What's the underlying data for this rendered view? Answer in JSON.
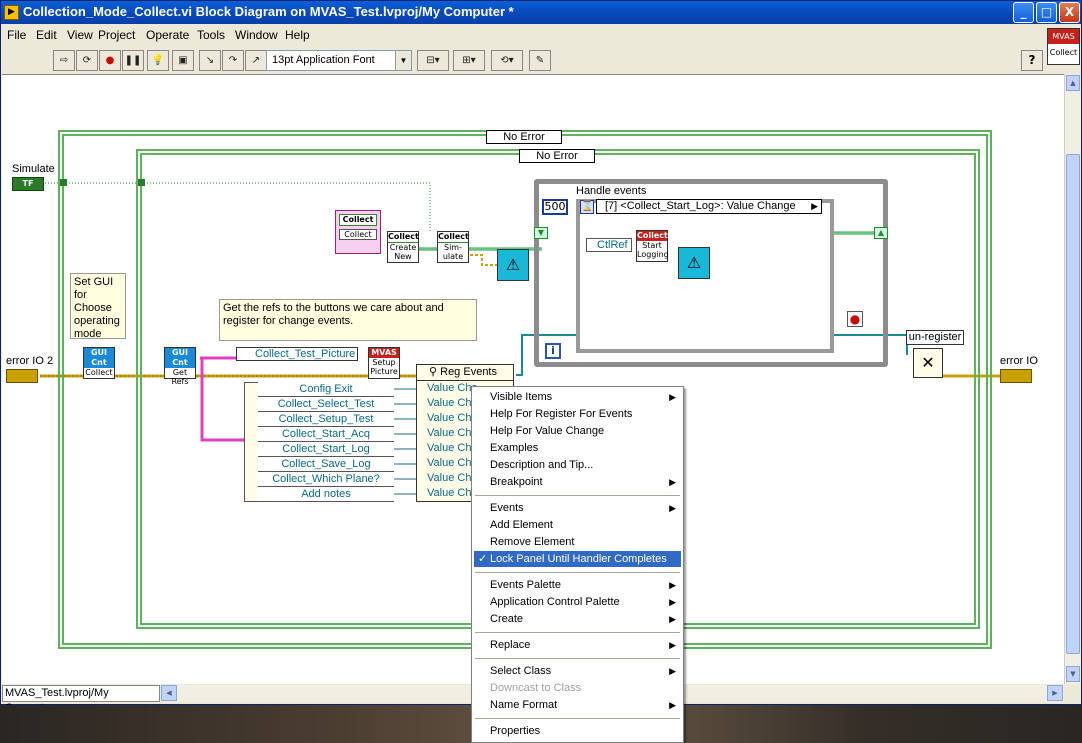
{
  "window": {
    "title": "Collection_Mode_Collect.vi Block Diagram on MVAS_Test.lvproj/My Computer *",
    "title_icon_glyph": "▶",
    "minimize": "_",
    "maximize": "□",
    "close": "X"
  },
  "menu": [
    {
      "label": "File"
    },
    {
      "label": "Edit"
    },
    {
      "label": "View"
    },
    {
      "label": "Project"
    },
    {
      "label": "Operate"
    },
    {
      "label": "Tools"
    },
    {
      "label": "Window"
    },
    {
      "label": "Help"
    }
  ],
  "toolbar": {
    "font": "13pt Application Font",
    "help": "?"
  },
  "vi_icon": {
    "top": "MVAS",
    "bottom": "Collect"
  },
  "diagram": {
    "outer_case": "No Error",
    "inner_case": "No Error",
    "simulate_label": "Simulate",
    "simulate_value": "TF",
    "note_set_gui": "Set GUI for Choose operating mode",
    "note_refs": "Get the refs to the buttons we care about and register for change events.",
    "error_in": "error IO 2",
    "error_out": "error IO",
    "gui_cntl_collect": {
      "hd": "GUI Cnt",
      "body": "Collect"
    },
    "gui_cntl_refs": {
      "hd": "GUI Cnt",
      "body": "Get Refs"
    },
    "collect_class": {
      "hd": "Collect",
      "body": "Collect"
    },
    "collect_create": {
      "hd": "Collect",
      "body": "Create New"
    },
    "collect_simulate": {
      "hd": "Collect",
      "body": "Sim-ulate"
    },
    "collect_start_logging": {
      "hd": "Collect",
      "body": "Start Logging"
    },
    "mvas_setup": {
      "hd": "MVAS",
      "body": "Setup Picture"
    },
    "test_picture": "Collect_Test_Picture",
    "reg_events": "Reg Events",
    "handle_events": "Handle events",
    "timeout": "500",
    "event_case": "[7] <Collect_Start_Log>: Value Change",
    "ctl_ref": "CtlRef",
    "iteration": "i",
    "unregister": "un-register",
    "controls": [
      "Config Exit",
      "Collect_Select_Test",
      "Collect_Setup_Test",
      "Collect_Start_Acq",
      "Collect_Start_Log",
      "Collect_Save_Log",
      "Collect_Which Plane?",
      "Add notes"
    ],
    "event_types": [
      "Value Cha",
      "Value Cha",
      "Value Cha",
      "Value Cha",
      "Value Cha",
      "Value Cha",
      "Value Cha",
      "Value Cha"
    ]
  },
  "context_menu": [
    {
      "label": "Visible Items",
      "submenu": true
    },
    {
      "label": "Help For Register For Events"
    },
    {
      "label": "Help For Value Change"
    },
    {
      "label": "Examples"
    },
    {
      "label": "Description and Tip..."
    },
    {
      "label": "Breakpoint",
      "submenu": true
    },
    {
      "separator": true
    },
    {
      "label": "Events",
      "submenu": true
    },
    {
      "label": "Add Element"
    },
    {
      "label": "Remove Element"
    },
    {
      "label": "Lock Panel Until Handler Completes",
      "checked": true,
      "selected": true
    },
    {
      "separator": true
    },
    {
      "label": "Events Palette",
      "submenu": true
    },
    {
      "label": "Application Control Palette",
      "submenu": true
    },
    {
      "label": "Create",
      "submenu": true
    },
    {
      "separator": true
    },
    {
      "label": "Replace",
      "submenu": true
    },
    {
      "separator": true
    },
    {
      "label": "Select Class",
      "submenu": true
    },
    {
      "label": "Downcast to Class",
      "disabled": true
    },
    {
      "label": "Name Format",
      "submenu": true
    },
    {
      "separator": true
    },
    {
      "label": "Properties"
    }
  ],
  "status": {
    "path": "MVAS_Test.lvproj/My Computer"
  }
}
